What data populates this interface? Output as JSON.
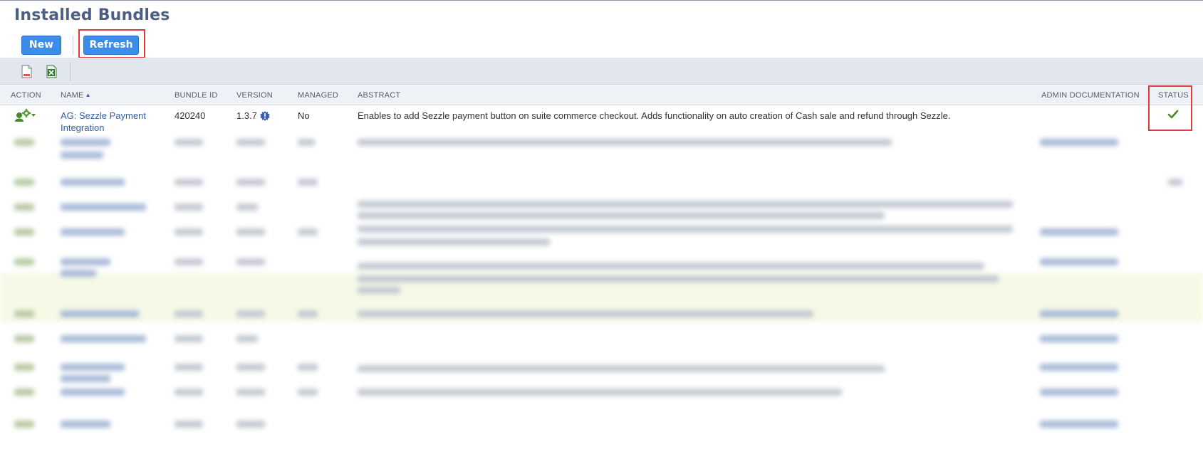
{
  "page": {
    "title": "Installed Bundles"
  },
  "buttons": {
    "new_label": "New",
    "refresh_label": "Refresh"
  },
  "toolbar": {
    "icons": [
      "page-icon",
      "excel-icon"
    ]
  },
  "table": {
    "columns": {
      "action": "ACTION",
      "name": "NAME",
      "bundle_id": "BUNDLE ID",
      "version": "VERSION",
      "managed": "MANAGED",
      "abstract": "ABSTRACT",
      "admin_documentation": "ADMIN DOCUMENTATION",
      "status": "STATUS"
    },
    "sort": {
      "column": "name",
      "direction": "ascending",
      "indicator": "▲"
    },
    "rows": [
      {
        "action_icon": "gear-user-icon",
        "name": "AG: Sezzle Payment Integration",
        "bundle_id": "420240",
        "version": "1.3.7",
        "version_icon": "badge-icon",
        "managed": "No",
        "abstract": "Enables to add Sezzle payment button on suite commerce checkout. Adds functionality on auto creation of Cash sale and refund through Sezzle.",
        "admin_documentation": "",
        "status_icon": "check-icon"
      }
    ]
  },
  "colors": {
    "title": "#4d5f80",
    "button": "#3b8de8",
    "highlight": "#e03a3a",
    "link": "#2f5ea6",
    "check": "#4a8a2e",
    "toolbar_band": "#e2e7ef"
  }
}
